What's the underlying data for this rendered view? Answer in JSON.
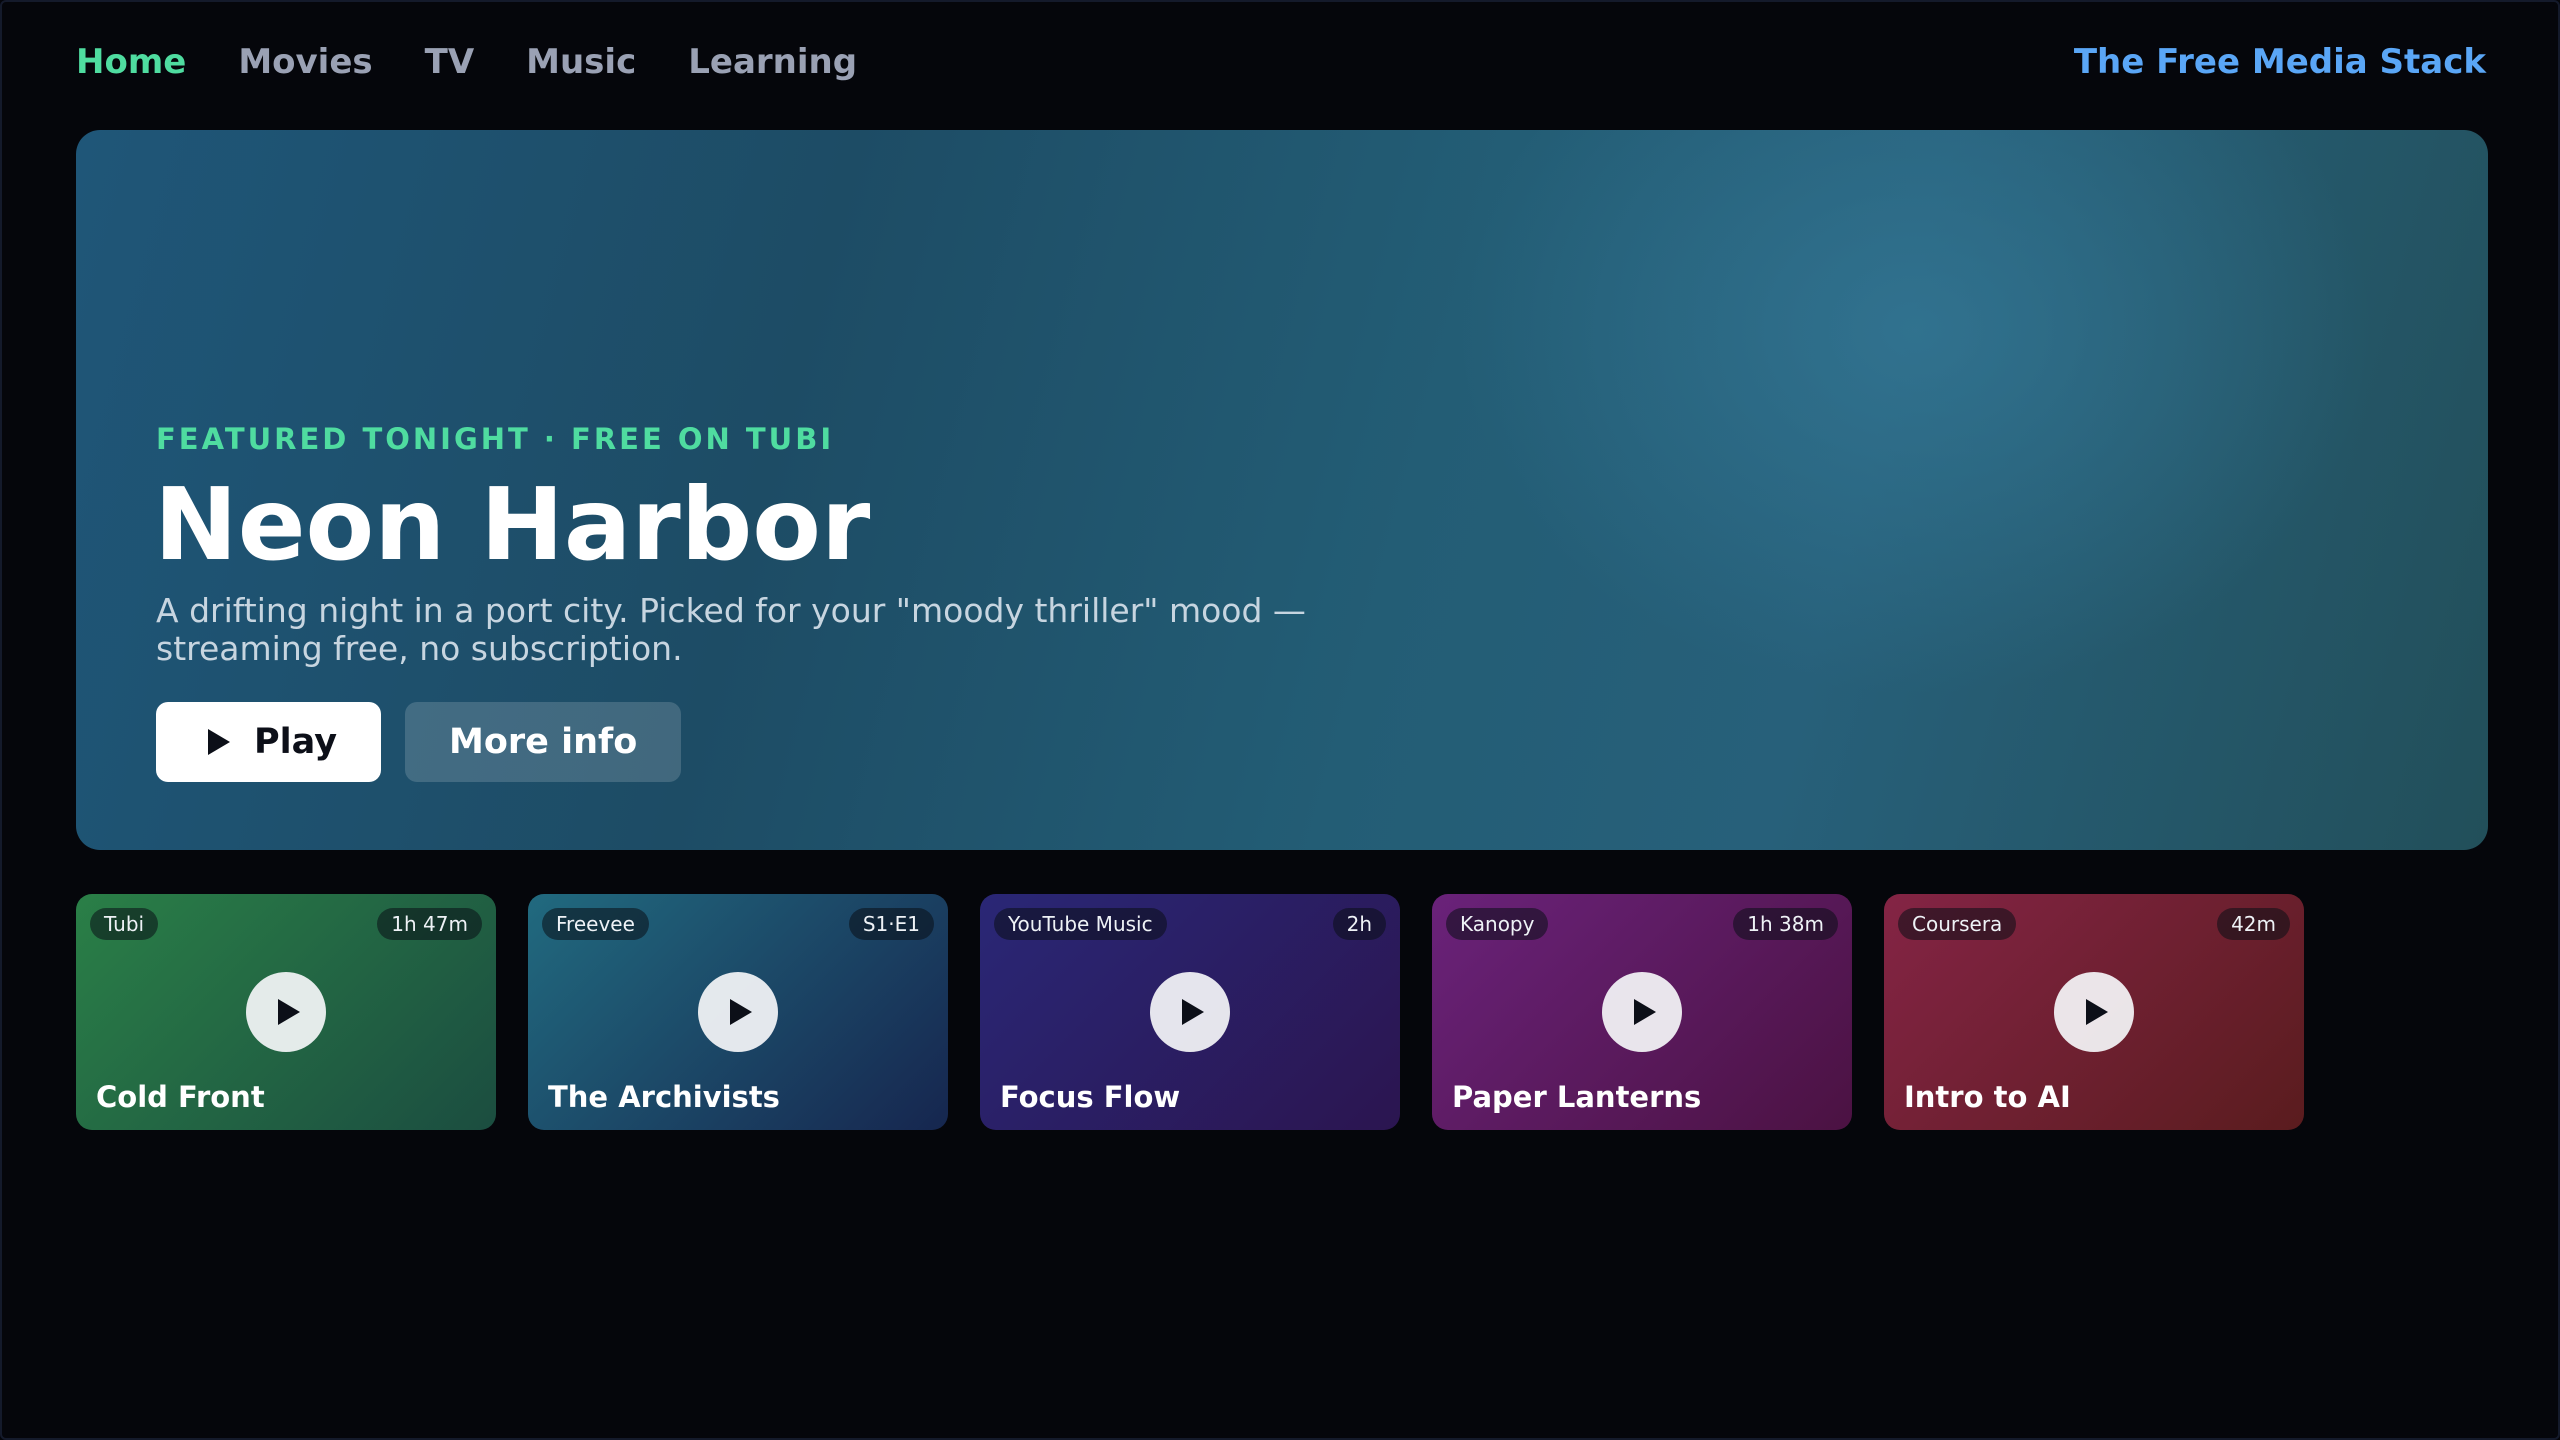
{
  "nav": {
    "items": [
      {
        "label": "Home",
        "active": true
      },
      {
        "label": "Movies",
        "active": false
      },
      {
        "label": "TV",
        "active": false
      },
      {
        "label": "Music",
        "active": false
      },
      {
        "label": "Learning",
        "active": false
      }
    ],
    "brand": "The Free Media Stack"
  },
  "hero": {
    "kicker": "FEATURED TONIGHT · FREE ON TUBI",
    "title": "Neon Harbor",
    "description": "A drifting night in a port city. Picked for your \"moody thriller\" mood — streaming free, no subscription.",
    "play_label": "Play",
    "info_label": "More info"
  },
  "cards": [
    {
      "provider": "Tubi",
      "duration": "1h 47m",
      "title": "Cold Front",
      "colors": [
        "#2a7f47",
        "#1b4d40"
      ]
    },
    {
      "provider": "Freevee",
      "duration": "S1·E1",
      "title": "The Archivists",
      "colors": [
        "#216a7f",
        "#16264f"
      ]
    },
    {
      "provider": "YouTube Music",
      "duration": "2h",
      "title": "Focus Flow",
      "colors": [
        "#2a2776",
        "#2b1550"
      ]
    },
    {
      "provider": "Kanopy",
      "duration": "1h 38m",
      "title": "Paper Lanterns",
      "colors": [
        "#6a227a",
        "#4b1242"
      ]
    },
    {
      "provider": "Coursera",
      "duration": "42m",
      "title": "Intro to AI",
      "colors": [
        "#842445",
        "#5a1c1e"
      ]
    }
  ],
  "theme": {
    "accent": "#4fdca0",
    "brand": "#5aa6f6",
    "background": "#05060b"
  }
}
